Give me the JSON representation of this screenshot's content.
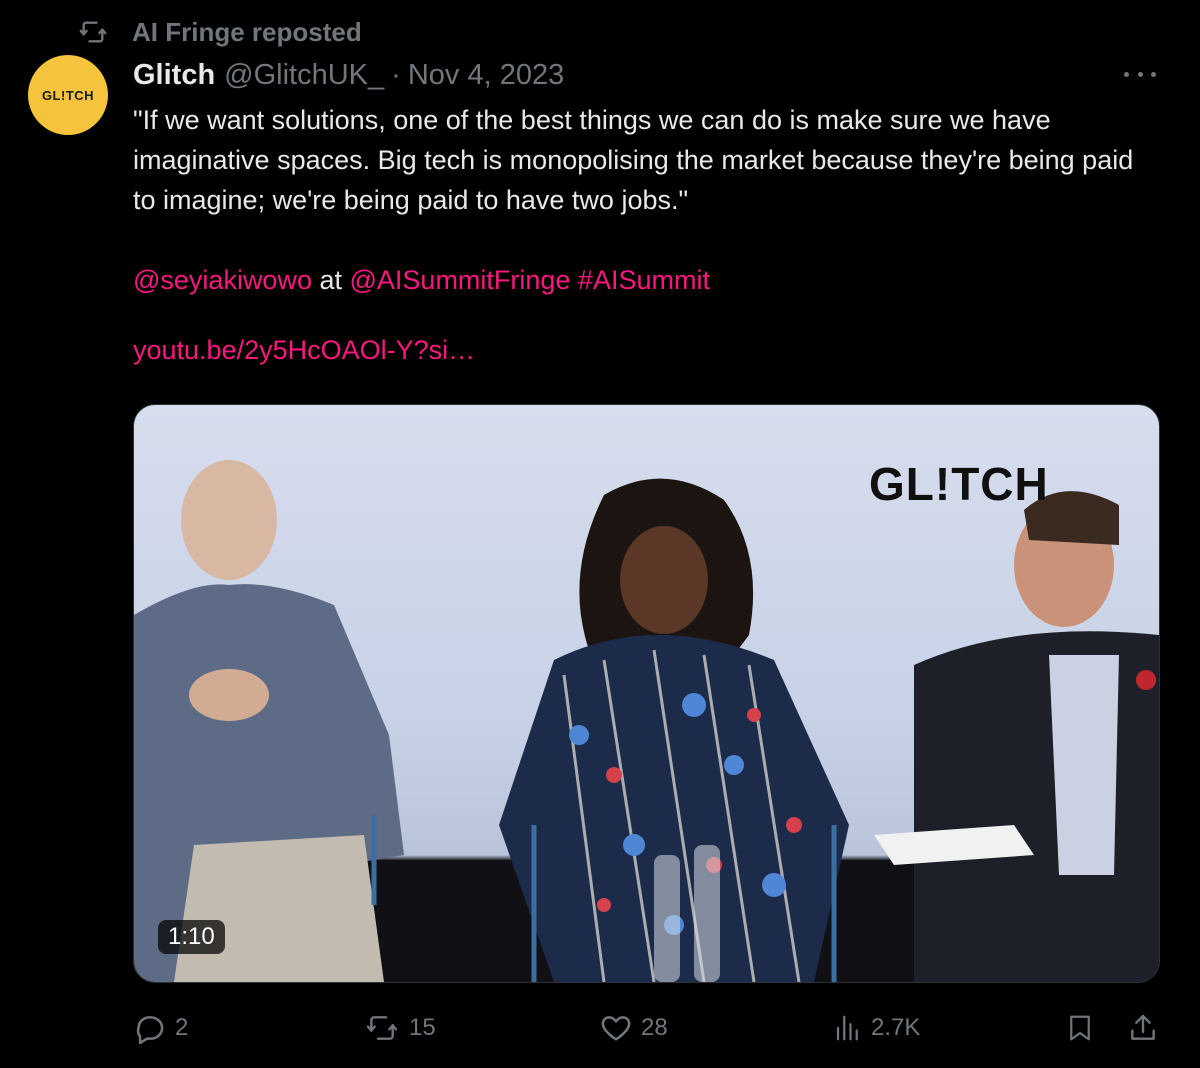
{
  "repost": {
    "icon": "repost-icon",
    "label": "AI Fringe reposted"
  },
  "author": {
    "avatar_text": "GL!TCH",
    "avatar_color": "#f6c33c",
    "name": "Glitch",
    "handle": "@GlitchUK_",
    "separator": "·",
    "date": "Nov 4, 2023"
  },
  "tweet": {
    "quote": "\"If we want solutions, one of the best things we can do is make sure we have imaginative spaces. Big tech is monopolising the market because they're being paid to imagine; we're being paid to have two jobs.\"",
    "mention1": "@seyiakiwowo",
    "at_word": " at ",
    "mention2": "@AISummitFringe",
    "hashtag": "#AISummit",
    "url": "youtu.be/2y5HcOAOl-Y?si…",
    "link_color": "#f91880"
  },
  "media": {
    "brand_text": "GL!TCH",
    "duration": "1:10"
  },
  "actions": {
    "replies": "2",
    "reposts": "15",
    "likes": "28",
    "views": "2.7K"
  }
}
